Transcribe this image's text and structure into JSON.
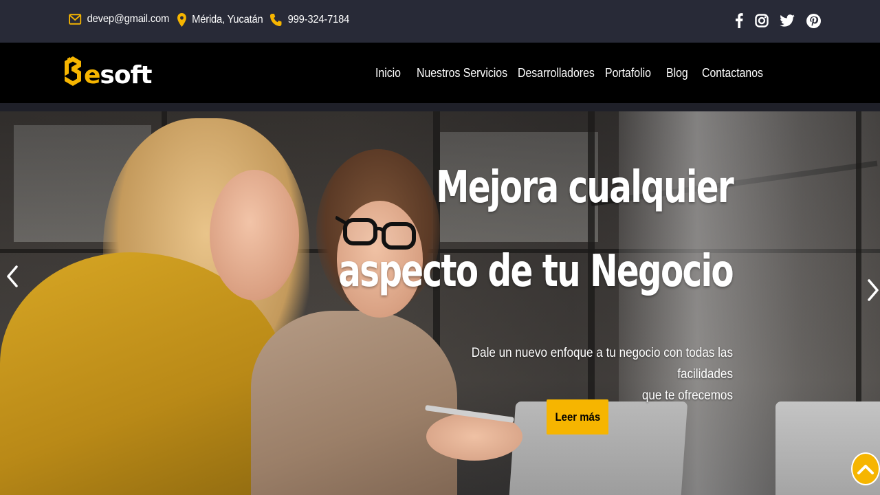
{
  "topbar": {
    "email": "devep@gmail.com",
    "location": "Mérida, Yucatán",
    "phone": "999-324-7184",
    "icons": [
      "envelope-icon",
      "map-pin-icon",
      "phone-icon"
    ],
    "social": [
      "facebook-icon",
      "instagram-icon",
      "twitter-icon",
      "pinterest-icon"
    ]
  },
  "logo": {
    "prefix": "e",
    "rest": "soft",
    "icon": "esoft-logo-mark"
  },
  "nav": {
    "items": [
      {
        "label": "Inicio"
      },
      {
        "label": "Nuestros Servicios"
      },
      {
        "label": "Desarrolladores"
      },
      {
        "label": "Portafolio"
      },
      {
        "label": "Blog"
      },
      {
        "label": "Contactanos"
      }
    ]
  },
  "hero": {
    "title_line1": "Mejora cualquier",
    "title_line2": "aspecto de tu Negocio",
    "subtitle_line1": "Dale un nuevo enfoque a tu negocio con todas las facilidades",
    "subtitle_line2": "que te ofrecemos",
    "cta_label": "Leer más",
    "prev_icon": "chevron-left-icon",
    "next_icon": "chevron-right-icon"
  },
  "scroll_top_icon": "chevron-up-icon",
  "colors": {
    "accent": "#f6b500",
    "topbar": "#282a37",
    "navbar": "#000000",
    "text": "#ffffff"
  }
}
